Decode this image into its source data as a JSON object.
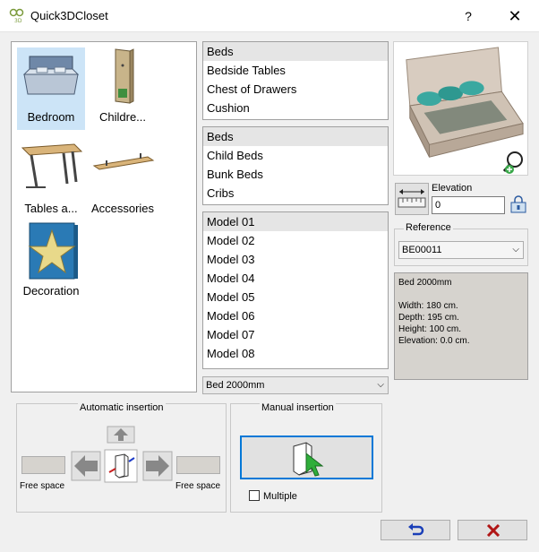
{
  "window": {
    "title": "Quick3DCloset",
    "help": "?",
    "close": "✕"
  },
  "categories": [
    {
      "label": "Bedroom",
      "icon": "bed-icon"
    },
    {
      "label": "Childre...",
      "icon": "wardrobe-icon"
    },
    {
      "label": "Tables a...",
      "icon": "table-icon"
    },
    {
      "label": "Accessories",
      "icon": "shelf-icon"
    },
    {
      "label": "Decoration",
      "icon": "star-decoration-icon"
    }
  ],
  "list1": {
    "items": [
      "Beds",
      "Bedside Tables",
      "Chest of Drawers",
      "Cushion"
    ],
    "selected": 0
  },
  "list2": {
    "items": [
      "Beds",
      "Child Beds",
      "Bunk Beds",
      "Cribs"
    ],
    "selected": 0
  },
  "list3": {
    "items": [
      "Model 01",
      "Model 02",
      "Model 03",
      "Model 04",
      "Model 05",
      "Model 06",
      "Model 07",
      "Model 08"
    ],
    "selected": 0
  },
  "model_combo": {
    "value": "Bed 2000mm"
  },
  "elevation": {
    "label": "Elevation",
    "value": "0"
  },
  "reference": {
    "label": "Reference",
    "value": "BE00011"
  },
  "info": {
    "name": "Bed 2000mm",
    "lines": [
      "Width: 180 cm.",
      "Depth: 195 cm.",
      "Height: 100 cm.",
      "Elevation: 0.0 cm."
    ]
  },
  "auto_insertion": {
    "title": "Automatic insertion",
    "left_label": "Free space",
    "right_label": "Free space"
  },
  "manual_insertion": {
    "title": "Manual insertion",
    "multiple_label": "Multiple",
    "multiple_checked": false
  },
  "colors": {
    "accent": "#0078d7",
    "selection": "#cce4f7",
    "ok_icon": "#1a3fb8",
    "cancel_icon": "#b01515"
  }
}
